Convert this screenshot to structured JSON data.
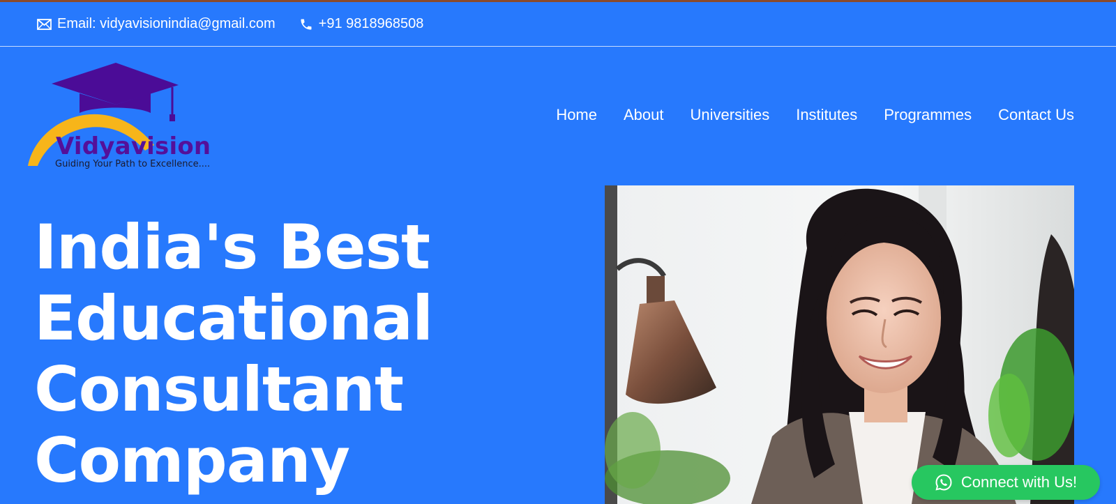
{
  "topbar": {
    "email_label": "Email: vidyavisionindia@gmail.com",
    "phone_label": "+91 9818968508"
  },
  "brand": {
    "name": "Vidyavision",
    "tagline": "Guiding Your Path to Excellence....",
    "colors": {
      "cap": "#4b0c97",
      "arc": "#f7b51a",
      "text": "#54109a"
    }
  },
  "nav": {
    "items": [
      {
        "label": "Home"
      },
      {
        "label": "About"
      },
      {
        "label": "Universities"
      },
      {
        "label": "Institutes"
      },
      {
        "label": "Programmes"
      },
      {
        "label": "Contact Us"
      }
    ]
  },
  "hero": {
    "headline_lines": [
      "India's Best",
      "Educational",
      "Consultant",
      "Company"
    ]
  },
  "cta": {
    "label": "Connect with Us!",
    "icon": "whatsapp-icon"
  },
  "colors": {
    "background": "#2779fd",
    "accent_green": "#27c760",
    "top_strip": "#8a4a2c"
  },
  "icons": {
    "email": "envelope-icon",
    "phone": "phone-icon"
  }
}
